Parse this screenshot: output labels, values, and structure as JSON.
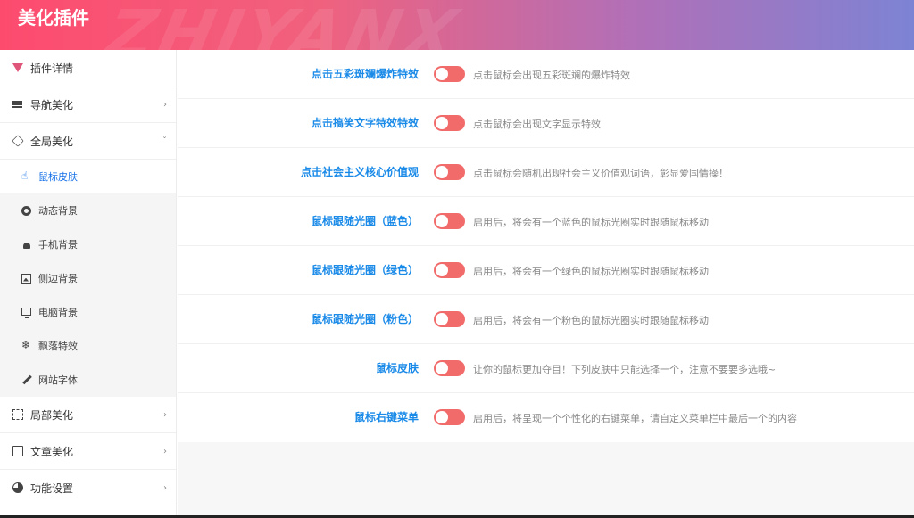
{
  "app": {
    "title": "美化插件",
    "watermark": "ZHIYANX"
  },
  "sidebar": {
    "items": [
      {
        "label": "插件详情",
        "icon": "plugin-logo-icon"
      },
      {
        "label": "导航美化",
        "icon": "menu-bars-icon",
        "arrow": "›"
      },
      {
        "label": "全局美化",
        "icon": "cube-icon",
        "arrow": "ˇ"
      },
      {
        "label": "局部美化",
        "icon": "frame-icon",
        "arrow": "›"
      },
      {
        "label": "文章美化",
        "icon": "edit-icon",
        "arrow": "›"
      },
      {
        "label": "功能设置",
        "icon": "pie-chart-icon",
        "arrow": "›"
      }
    ],
    "subitems": [
      {
        "label": "鼠标皮肤",
        "icon": "hand-pointer-icon",
        "active": true
      },
      {
        "label": "动态背景",
        "icon": "life-ring-icon"
      },
      {
        "label": "手机背景",
        "icon": "android-icon"
      },
      {
        "label": "侧边背景",
        "icon": "image-icon"
      },
      {
        "label": "电脑背景",
        "icon": "monitor-icon"
      },
      {
        "label": "飘落特效",
        "icon": "snowflake-icon"
      },
      {
        "label": "网站字体",
        "icon": "pen-icon"
      }
    ]
  },
  "settings": [
    {
      "label": "点击五彩斑斓爆炸特效",
      "desc": "点击鼠标会出现五彩斑斓的爆炸特效",
      "enabled": false
    },
    {
      "label": "点击搞笑文字特效特效",
      "desc": "点击鼠标会出现文字显示特效",
      "enabled": false
    },
    {
      "label": "点击社会主义核心价值观",
      "desc": "点击鼠标会随机出现社会主义价值观词语，彰显爱国情操！",
      "enabled": false
    },
    {
      "label": "鼠标跟随光圈（蓝色）",
      "desc": "启用后，将会有一个蓝色的鼠标光圈实时跟随鼠标移动",
      "enabled": false
    },
    {
      "label": "鼠标跟随光圈（绿色）",
      "desc": "启用后，将会有一个绿色的鼠标光圈实时跟随鼠标移动",
      "enabled": false
    },
    {
      "label": "鼠标跟随光圈（粉色）",
      "desc": "启用后，将会有一个粉色的鼠标光圈实时跟随鼠标移动",
      "enabled": false
    },
    {
      "label": "鼠标皮肤",
      "desc": "让你的鼠标更加夺目！下列皮肤中只能选择一个，注意不要要多选哦~",
      "enabled": false
    },
    {
      "label": "鼠标右键菜单",
      "desc": "启用后，将呈现一个个性化的右键菜单，请自定义菜单栏中最后一个的内容",
      "enabled": false
    }
  ],
  "colors": {
    "accent": "#1a8ae8",
    "toggle_off": "#f26b6b",
    "header_start": "#fd4b6e",
    "header_end": "#7d83d4"
  }
}
